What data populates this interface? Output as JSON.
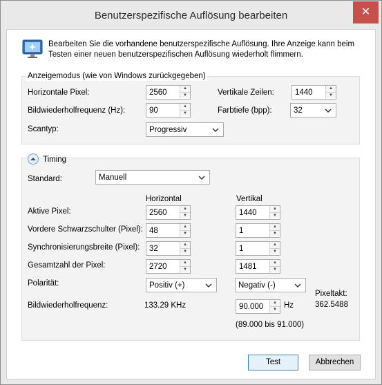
{
  "window": {
    "title": "Benutzerspezifische Auflösung bearbeiten",
    "close_glyph": "✕"
  },
  "intro": {
    "icon": "monitor-icon",
    "text": "Bearbeiten Sie die vorhandene benutzerspezifische Auflösung. Ihre Anzeige kann beim Testen einer neuen benutzerspezifischen Auflösung wiederholt flimmern."
  },
  "display_mode": {
    "group_label": "Anzeigemodus (wie von Windows zurückgegeben)",
    "horizontal_pixels_label": "Horizontale Pixel:",
    "horizontal_pixels": "2560",
    "vertical_lines_label": "Vertikale Zeilen:",
    "vertical_lines": "1440",
    "refresh_label": "Bildwiederholfrequenz (Hz):",
    "refresh": "90",
    "color_depth_label": "Farbtiefe (bpp):",
    "color_depth": "32",
    "scan_type_label": "Scantyp:",
    "scan_type": "Progressiv"
  },
  "timing": {
    "label": "Timing",
    "standard_label": "Standard:",
    "standard": "Manuell",
    "col_horizontal": "Horizontal",
    "col_vertical": "Vertikal",
    "active_label": "Aktive Pixel:",
    "active_h": "2560",
    "active_v": "1440",
    "front_porch_label": "Vordere Schwarzschulter (Pixel):",
    "front_porch_h": "48",
    "front_porch_v": "1",
    "sync_width_label": "Synchronisierungsbreite (Pixel):",
    "sync_width_h": "32",
    "sync_width_v": "1",
    "total_label": "Gesamtzahl der Pixel:",
    "total_h": "2720",
    "total_v": "1481",
    "polarity_label": "Polarität:",
    "polarity_h": "Positiv (+)",
    "polarity_v": "Negativ (-)",
    "refresh_label": "Bildwiederholfrequenz:",
    "refresh_h": "133.29 KHz",
    "refresh_v": "90.000",
    "refresh_unit": "Hz",
    "refresh_range": "(89.000 bis 91.000)",
    "pixel_clock_label": "Pixeltakt:",
    "pixel_clock": "362.5488"
  },
  "buttons": {
    "test": "Test",
    "cancel": "Abbrechen"
  }
}
